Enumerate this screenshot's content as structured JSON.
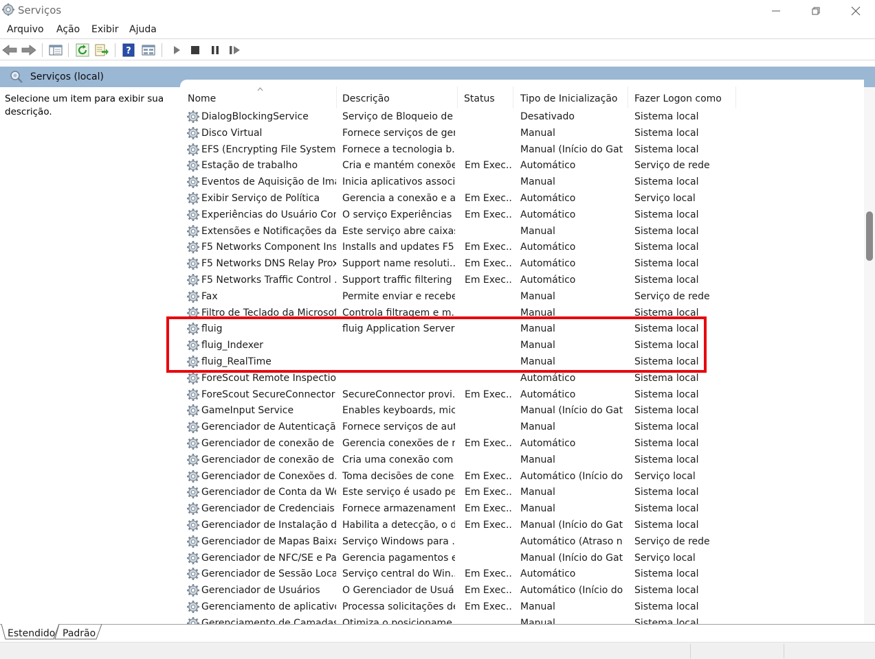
{
  "window": {
    "title": "Serviços"
  },
  "menu": [
    "Arquivo",
    "Ação",
    "Exibir",
    "Ajuda"
  ],
  "toolbar_icons": [
    "back-arrow-icon",
    "forward-arrow-icon",
    "console-tree-icon",
    "refresh-icon",
    "export-list-icon",
    "help-icon",
    "properties-icon",
    "play-icon",
    "stop-icon",
    "pause-icon",
    "resume-icon"
  ],
  "header": {
    "title": "Serviços (local)"
  },
  "description_pane": {
    "text": "Selecione um item para exibir sua descrição."
  },
  "columns": [
    "Nome",
    "Descrição",
    "Status",
    "Tipo de Inicialização",
    "Fazer Logon como"
  ],
  "services": [
    [
      "DialogBlockingService",
      "Serviço de Bloqueio de ...",
      "",
      "Desativado",
      "Sistema local"
    ],
    [
      "Disco Virtual",
      "Fornece serviços de ger...",
      "",
      "Manual",
      "Sistema local"
    ],
    [
      "EFS (Encrypting File System)",
      "Fornece a tecnologia b...",
      "",
      "Manual (Início do Gat...",
      "Sistema local"
    ],
    [
      "Estação de trabalho",
      "Cria e mantém conexõe...",
      "Em Exec...",
      "Automático",
      "Serviço de rede"
    ],
    [
      "Eventos de Aquisição de Ima...",
      "Inicia aplicativos associ...",
      "",
      "Manual",
      "Sistema local"
    ],
    [
      "Exibir Serviço de Política",
      "Gerencia a conexão e a ...",
      "Em Exec...",
      "Automático",
      "Serviço local"
    ],
    [
      "Experiências do Usuário Con...",
      "O serviço Experiências ...",
      "Em Exec...",
      "Automático",
      "Sistema local"
    ],
    [
      "Extensões e Notificações da ...",
      "Este serviço abre caixas ...",
      "",
      "Manual",
      "Sistema local"
    ],
    [
      "F5 Networks Component Ins...",
      "Installs and updates F5 ...",
      "Em Exec...",
      "Automático",
      "Sistema local"
    ],
    [
      "F5 Networks DNS Relay Prox...",
      "Support name resoluti...",
      "Em Exec...",
      "Automático",
      "Sistema local"
    ],
    [
      "F5 Networks Traffic Control ...",
      "Support traffic filtering ...",
      "Em Exec...",
      "Automático",
      "Sistema local"
    ],
    [
      "Fax",
      "Permite enviar e recebe...",
      "",
      "Manual",
      "Serviço de rede"
    ],
    [
      "Filtro de Teclado da Microsoft",
      "Controla filtragem e m...",
      "",
      "Manual",
      "Sistema local"
    ],
    [
      "fluig",
      "fluig Application Server",
      "",
      "Manual",
      "Sistema local"
    ],
    [
      "fluig_Indexer",
      "",
      "",
      "Manual",
      "Sistema local"
    ],
    [
      "fluig_RealTime",
      "",
      "",
      "Manual",
      "Sistema local"
    ],
    [
      "ForeScout Remote Inspectio...",
      "",
      "",
      "Automático",
      "Sistema local"
    ],
    [
      "ForeScout SecureConnector ...",
      "SecureConnector provi...",
      "Em Exec...",
      "Automático",
      "Sistema local"
    ],
    [
      "GameInput Service",
      "Enables keyboards, mic...",
      "",
      "Manual (Início do Gat...",
      "Sistema local"
    ],
    [
      "Gerenciador de Autenticaçã...",
      "Fornece serviços de aut...",
      "",
      "Manual",
      "Sistema local"
    ],
    [
      "Gerenciador de conexão de ...",
      "Gerencia conexões de r...",
      "Em Exec...",
      "Automático",
      "Sistema local"
    ],
    [
      "Gerenciador de conexão de ...",
      "Cria uma conexão com ...",
      "",
      "Manual",
      "Sistema local"
    ],
    [
      "Gerenciador de Conexões d...",
      "Toma decisões de cone...",
      "Em Exec...",
      "Automático (Início do...",
      "Serviço local"
    ],
    [
      "Gerenciador de Conta da Web",
      "Este serviço é usado pe...",
      "Em Exec...",
      "Manual",
      "Sistema local"
    ],
    [
      "Gerenciador de Credenciais",
      "Fornece armazenament...",
      "Em Exec...",
      "Manual",
      "Sistema local"
    ],
    [
      "Gerenciador de Instalação d...",
      "Habilita a detecção, o d...",
      "Em Exec...",
      "Manual (Início do Gat...",
      "Sistema local"
    ],
    [
      "Gerenciador de Mapas Baixa...",
      "Serviço Windows para ...",
      "",
      "Automático (Atraso n...",
      "Serviço de rede"
    ],
    [
      "Gerenciador de NFC/SE e Pa...",
      "Gerencia pagamentos e...",
      "",
      "Manual (Início do Gat...",
      "Serviço local"
    ],
    [
      "Gerenciador de Sessão Local",
      "Serviço central do Win...",
      "Em Exec...",
      "Automático",
      "Sistema local"
    ],
    [
      "Gerenciador de Usuários",
      "O Gerenciador de Usuá...",
      "Em Exec...",
      "Automático (Início do...",
      "Sistema local"
    ],
    [
      "Gerenciamento de aplicativo",
      "Processa solicitações de...",
      "Em Exec...",
      "Manual",
      "Sistema local"
    ],
    [
      "Gerenciamento de Camadas ...",
      "Otimiza o posicioname...",
      "",
      "Manual",
      "Sistema local"
    ]
  ],
  "tabs": [
    "Estendido",
    "Padrão"
  ],
  "colors": {
    "header_bar": "#9ab7d4",
    "highlight": "#e8070e"
  }
}
